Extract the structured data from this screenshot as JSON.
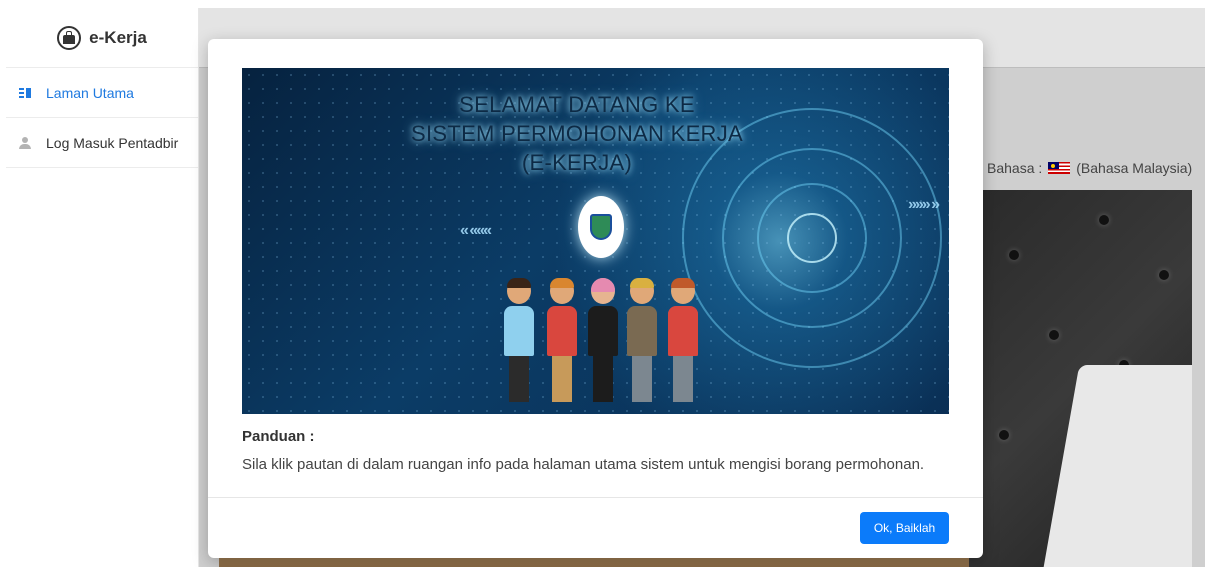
{
  "brand": {
    "title": "e-Kerja",
    "icon": "briefcase-icon"
  },
  "sidebar": {
    "items": [
      {
        "label": "Laman Utama",
        "icon": "book-icon",
        "active": true
      },
      {
        "label": "Log Masuk Pentadbir",
        "icon": "user-icon",
        "active": false
      }
    ]
  },
  "main": {
    "language_label": "Bahasa :",
    "language_value": "(Bahasa Malaysia)",
    "language_flag": "malaysia-flag-icon"
  },
  "modal": {
    "banner": {
      "line1": "SELAMAT DATANG KE",
      "line2": "SISTEM PERMOHONAN KERJA",
      "line3": "(E-KERJA)"
    },
    "guide_title": "Panduan :",
    "guide_text": "Sila klik pautan di dalam ruangan info pada halaman utama sistem untuk mengisi borang permohonan.",
    "ok_label": "Ok, Baiklah"
  },
  "colors": {
    "accent": "#0b7bfa",
    "active_nav": "#1f7ae0",
    "overlay": "#cfcfcf"
  }
}
